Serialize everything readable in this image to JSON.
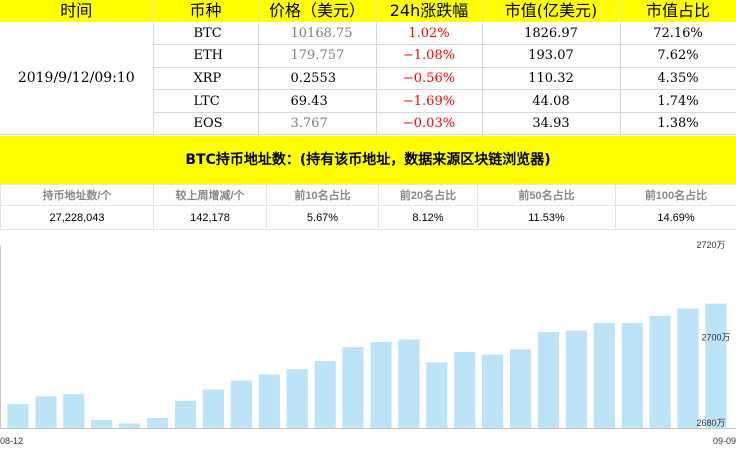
{
  "price_table": {
    "headers": [
      "时间",
      "币种",
      "价格（美元）",
      "24h涨跌幅",
      "市值(亿美元)",
      "市值占比"
    ],
    "time": "2019/9/12/09:10",
    "rows": [
      {
        "coin": "BTC",
        "price": "10168.75",
        "change": "1.02%",
        "market_cap": "1826.97",
        "share": "72.16%"
      },
      {
        "coin": "ETH",
        "price": "179.757",
        "change": "-1.08%",
        "market_cap": "193.07",
        "share": "7.62%"
      },
      {
        "coin": "XRP",
        "price": "0.2553",
        "change": "-0.56%",
        "market_cap": "110.32",
        "share": "4.35%"
      },
      {
        "coin": "LTC",
        "price": "69.43",
        "change": "-1.69%",
        "market_cap": "44.08",
        "share": "1.74%"
      },
      {
        "coin": "EOS",
        "price": "3.767",
        "change": "-0.03%",
        "market_cap": "34.93",
        "share": "1.38%"
      }
    ]
  },
  "banner": {
    "title": "BTC持币地址数：(持有该币地址，数据来源区块链浏览器)"
  },
  "address_table": {
    "headers": [
      "持币地址数/个",
      "较上周增减/个",
      "前10名占比",
      "前20名占比",
      "前50名占比",
      "前100名占比"
    ],
    "values": [
      "27,228,043",
      "142,178",
      "5.67%",
      "8.12%",
      "11.53%",
      "14.69%"
    ]
  },
  "colors": {
    "header_bg": "#ffff00",
    "negative": "#ff0000",
    "bar": "#bde3f7"
  },
  "chart_data": {
    "type": "bar",
    "x_start_label": "08-12",
    "x_end_label": "09-09",
    "y_tick_labels": [
      "2720万",
      "2700万",
      "2680万"
    ],
    "y_ticks": [
      2720,
      2700,
      2680
    ],
    "ylim": [
      2680,
      2720
    ],
    "unit": "万",
    "values": [
      2685.3,
      2687.0,
      2687.5,
      2681.8,
      2681.0,
      2682.2,
      2686.0,
      2688.5,
      2690.5,
      2691.8,
      2693.0,
      2694.8,
      2697.9,
      2699.0,
      2699.6,
      2694.5,
      2696.8,
      2696.2,
      2697.4,
      2701.2,
      2701.5,
      2703.2,
      2703.2,
      2704.8,
      2706.4,
      2707.5
    ]
  }
}
